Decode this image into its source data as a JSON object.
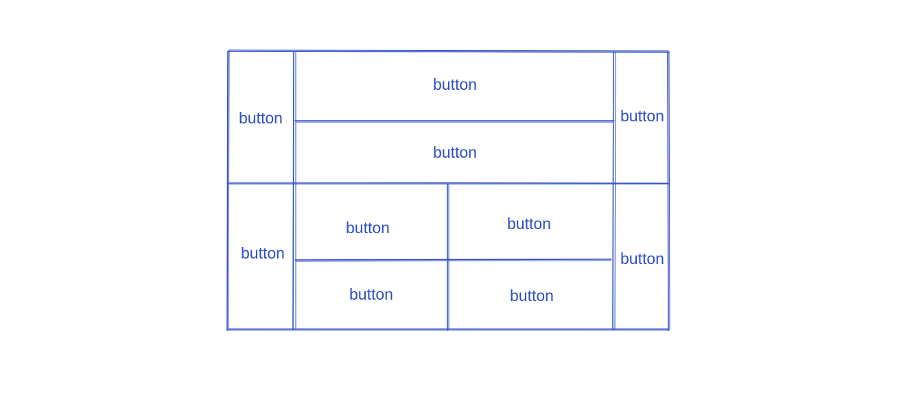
{
  "colors": {
    "stroke": "#3050c8",
    "text": "#2f4fc4",
    "background": "#ffffff"
  },
  "buttons": [
    {
      "label": "button"
    },
    {
      "label": "button"
    },
    {
      "label": "button"
    },
    {
      "label": "button"
    },
    {
      "label": "button"
    },
    {
      "label": "button"
    },
    {
      "label": "button"
    },
    {
      "label": "button"
    },
    {
      "label": "button"
    },
    {
      "label": "button"
    }
  ]
}
